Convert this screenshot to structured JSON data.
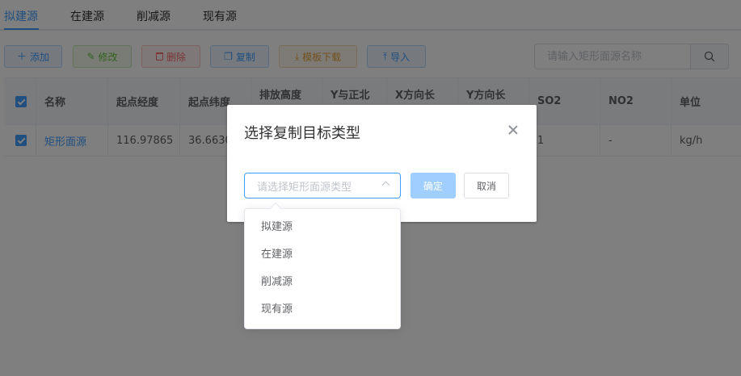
{
  "tabs": [
    {
      "label": "拟建源",
      "active": true
    },
    {
      "label": "在建源",
      "active": false
    },
    {
      "label": "削减源",
      "active": false
    },
    {
      "label": "现有源",
      "active": false
    }
  ],
  "toolbar": {
    "add_label": "添加",
    "edit_label": "修改",
    "delete_label": "删除",
    "copy_label": "复制",
    "template_label": "模板下载",
    "import_label": "导入",
    "search_placeholder": "请输入矩形面源名称"
  },
  "table": {
    "columns": [
      "名称",
      "起点经度",
      "起点纬度",
      "排放高度",
      "Y与正北",
      "X方向长",
      "Y方向长",
      "SO2",
      "NO2",
      "单位"
    ],
    "rows": [
      {
        "checked": true,
        "name": "矩形面源",
        "lon": "116.97865",
        "lat": "36.6630",
        "so2": "1",
        "no2": "-",
        "unit": "kg/h"
      }
    ],
    "header_checked": true
  },
  "dialog": {
    "title": "选择复制目标类型",
    "select_placeholder": "请选择矩形面源类型",
    "ok_label": "确定",
    "cancel_label": "取消",
    "options": [
      "拟建源",
      "在建源",
      "削减源",
      "现有源"
    ]
  },
  "colors": {
    "primary": "#409eff",
    "success": "#67c23a",
    "danger": "#f56c6c",
    "warning": "#e6a23c",
    "overlay": "rgba(0,0,0,0.5)"
  }
}
